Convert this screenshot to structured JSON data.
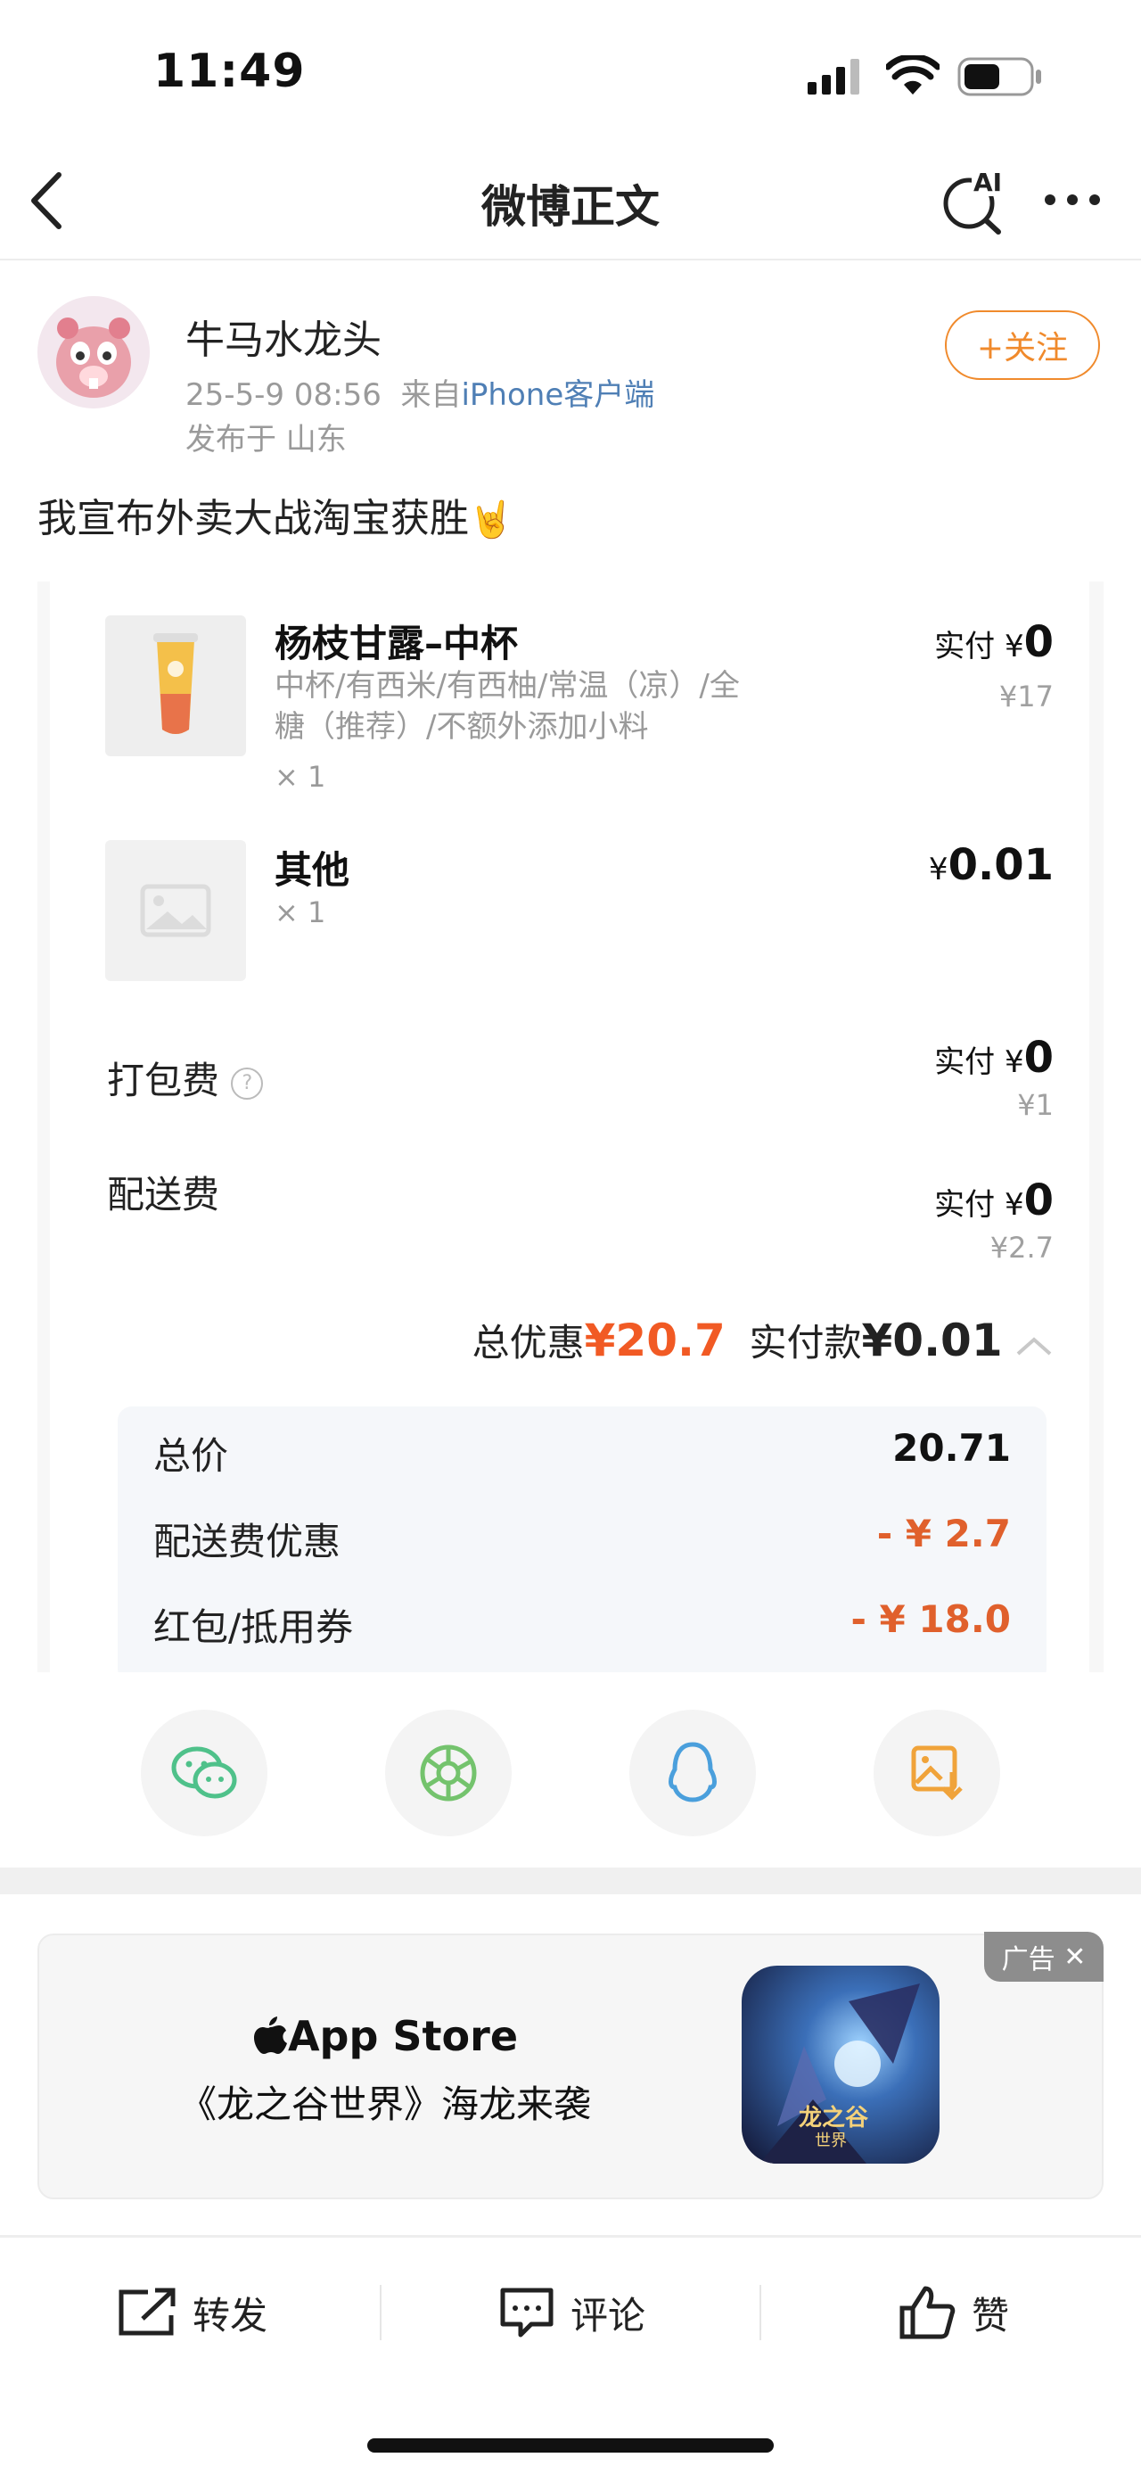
{
  "status_bar": {
    "time": "11:49",
    "battery_level": 0.55
  },
  "nav": {
    "title": "微博正文",
    "ai_label": "AI"
  },
  "post": {
    "author": "牛马水龙头",
    "date": "25-5-9 08:56",
    "from_prefix": "来自",
    "source": "iPhone客户端",
    "location": "发布于 山东",
    "follow_label": "+关注",
    "text": "我宣布外卖大战淘宝获胜",
    "emoji": "🤘"
  },
  "order": {
    "items": [
      {
        "title": "杨枝甘露–中杯",
        "desc_line1": "中杯/有西米/有西柚/常温（凉）/全",
        "desc_line2": "糖（推荐）/不额外添加小料",
        "qty": "× 1",
        "paid_prefix": "实付 ¥",
        "paid_value": "0",
        "original": "¥17"
      },
      {
        "title": "其他",
        "qty": "× 1",
        "paid_prefix": "¥",
        "paid_value": "0.01"
      }
    ],
    "fees": [
      {
        "label": "打包费",
        "help_icon": "?",
        "paid_prefix": "实付 ¥",
        "paid_value": "0",
        "original": "¥1"
      },
      {
        "label": "配送费",
        "paid_prefix": "实付 ¥",
        "paid_value": "0",
        "original": "¥2.7"
      }
    ],
    "summary": {
      "discount_label": "总优惠",
      "discount_value": "¥20.7",
      "paid_label": "实付款",
      "paid_value": "¥0.01"
    },
    "breakdown": [
      {
        "label": "总价",
        "value": "20.71",
        "color": "#111111"
      },
      {
        "label": "配送费优惠",
        "value": "- ¥ 2.7",
        "color": "#e0602c"
      },
      {
        "label": "红包/抵用券",
        "value": "- ¥ 18.0",
        "color": "#e0602c"
      }
    ]
  },
  "share": [
    "wechat-icon",
    "moments-icon",
    "qq-icon",
    "save-image-icon"
  ],
  "ad": {
    "tag": "广告",
    "close": "✕",
    "brand": "App Store",
    "headline": "《龙之谷世界》海龙来袭",
    "game_logo_text": "龙之谷",
    "game_logo_sub": "世界"
  },
  "actions": {
    "repost": "转发",
    "comment": "评论",
    "like": "赞"
  },
  "colors": {
    "accent_orange": "#f08a2c",
    "link_blue": "#4f7fb5",
    "discount_red": "#f15a24"
  }
}
